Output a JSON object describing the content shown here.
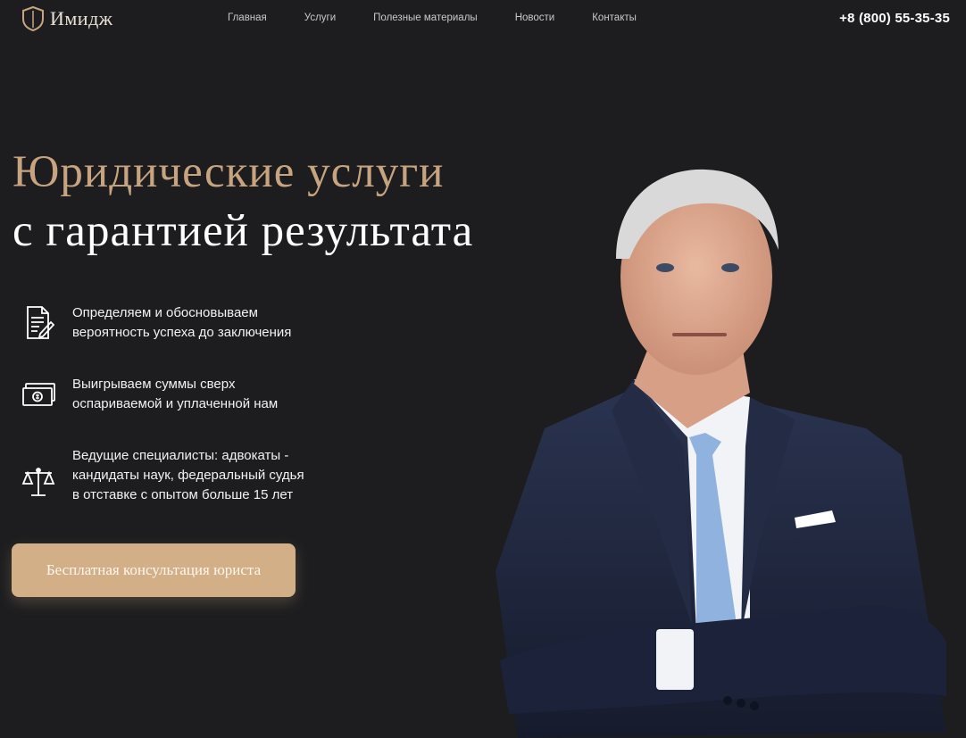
{
  "header": {
    "logo_text": "Имидж",
    "nav": [
      "Главная",
      "Услуги",
      "Полезные материалы",
      "Новости",
      "Контакты"
    ],
    "phone": "+8 (800) 55-35-35"
  },
  "hero": {
    "title_line1": "Юридические услуги",
    "title_line2": "с гарантией результата"
  },
  "features": [
    {
      "icon": "document-pen-icon",
      "text": "Определяем и обосновываем\nвероятность успеха до заключения"
    },
    {
      "icon": "money-bills-icon",
      "text": "Выигрываем суммы сверх\nоспариваемой и уплаченной нам"
    },
    {
      "icon": "scales-icon",
      "text": "Ведущие специалисты: адвокаты -\nкандидаты наук, федеральный судья\nв отставке с опытом  больше 15 лет"
    }
  ],
  "cta": {
    "label": "Бесплатная консультация юриста"
  },
  "colors": {
    "accent": "#c7a47f",
    "button": "#d2af86",
    "background": "#1d1d1f"
  }
}
